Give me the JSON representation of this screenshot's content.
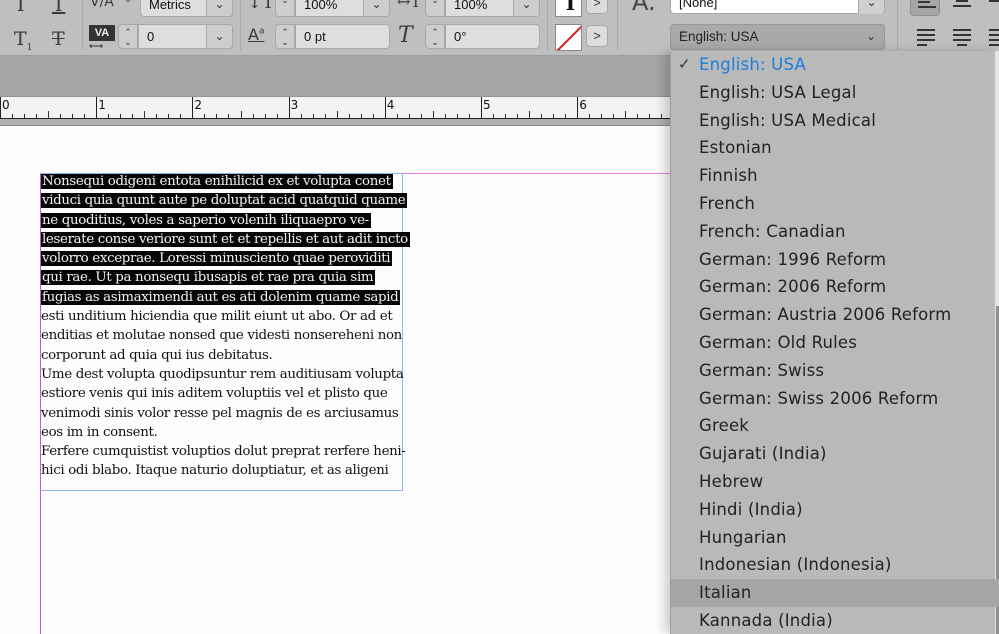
{
  "toolbar": {
    "kerning": {
      "value": "Metrics",
      "icon": "kerning-icon"
    },
    "tracking": {
      "value": "0",
      "icon": "tracking-icon"
    },
    "vertical_scale": {
      "value": "100%",
      "icon": "vertical-scale-icon"
    },
    "baseline_shift": {
      "value": "0 pt",
      "icon": "baseline-shift-icon"
    },
    "horizontal_scale": {
      "value": "100%",
      "icon": "horizontal-scale-icon"
    },
    "skew": {
      "value": "0°",
      "icon": "skew-icon"
    },
    "character_style": {
      "value": "[None]",
      "icon": "character-style-icon"
    },
    "language": {
      "value": "English: USA"
    },
    "stroke_arrow": ">",
    "fill_arrow": ">",
    "chevron": "⌄"
  },
  "ruler": {
    "labels": [
      "0",
      "1",
      "2",
      "3",
      "4",
      "5",
      "6"
    ]
  },
  "document": {
    "selected_lines": [
      "Nonsequi odigeni entota enihilicid ex et volupta conet",
      "viduci quia quunt aute pe doluptat acid quatquid quame",
      "ne quoditius, voles a saperio volenih iliquaepro ve-",
      "leserate conse veriore sunt et et repellis et aut adit incto",
      "volorro exceprae. Loressi minusciento quae peroviditi",
      "qui rae. Ut pa nonsequ ibusapis et rae pra quia sim",
      "fugias as asimaximendi aut es ati dolenim quame sapid"
    ],
    "lines": [
      "esti unditium hiciendia que milit eiunt ut abo. Or ad et",
      "enditias et molutae nonsed que videsti nonsereheni non",
      "corporunt ad quia qui ius debitatus.",
      "Ume dest volupta quodipsuntur rem auditiusam volupta",
      "estiore venis qui inis aditem voluptiis vel et plisto que",
      "venimodi sinis volor resse pel magnis de es arciusamus",
      "eos im in consent.",
      "Ferfere cumquistist voluptios dolut preprat rerfere heni-",
      "hici odi blabo. Itaque naturio doluptiatur, et as aligeni"
    ]
  },
  "language_menu": {
    "selected": "English: USA",
    "hovered": "Italian",
    "check_icon": "✓",
    "items": [
      "English: USA",
      "English: USA Legal",
      "English: USA Medical",
      "Estonian",
      "Finnish",
      "French",
      "French: Canadian",
      "German: 1996 Reform",
      "German: 2006 Reform",
      "German: Austria 2006 Reform",
      "German: Old Rules",
      "German: Swiss",
      "German: Swiss 2006 Reform",
      "Greek",
      "Gujarati (India)",
      "Hebrew",
      "Hindi (India)",
      "Hungarian",
      "Indonesian (Indonesia)",
      "Italian",
      "Kannada (India)"
    ]
  },
  "colors": {
    "selection_bg": "#050505",
    "menu_selected": "#1a7ee0",
    "margin_guide": "#d250e8",
    "frame_edge": "#85b6f0"
  }
}
